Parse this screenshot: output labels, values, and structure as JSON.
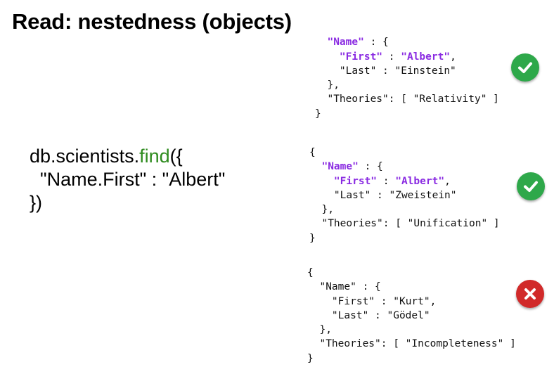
{
  "title": "Read: nestedness (objects)",
  "query": {
    "line1_prefix": "db.scientists.",
    "line1_fn": "find",
    "line1_suffix": "({",
    "line2": "  \"Name.First\" : \"Albert\"",
    "line3": "})"
  },
  "docs": [
    {
      "open_brace": "",
      "name_key": "\"Name\"",
      "name_open": " : {",
      "first_key": "\"First\"",
      "sep": " : ",
      "first_value": "\"Albert\"",
      "first_comma": ",",
      "last_line": "\"Last\" : \"Einstein\"",
      "name_close": "},",
      "theories_line": "\"Theories\": [ \"Relativity\" ]",
      "close_brace": "}",
      "result": "match",
      "result_icon": "check-icon"
    },
    {
      "open_brace": "{",
      "name_key": "\"Name\"",
      "name_open": " : {",
      "first_key": "\"First\"",
      "sep": " : ",
      "first_value": "\"Albert\"",
      "first_comma": ",",
      "last_line": "\"Last\" : \"Zweistein\"",
      "name_close": "},",
      "theories_line": "\"Theories\": [ \"Unification\" ]",
      "close_brace": "}",
      "result": "match",
      "result_icon": "check-icon"
    },
    {
      "open_brace": "{",
      "name_key": "\"Name\"",
      "name_open": " : {",
      "first_key": "\"First\"",
      "sep": " : ",
      "first_value": "\"Kurt\"",
      "first_comma": ",",
      "last_line": "\"Last\" : \"Gödel\"",
      "name_close": "},",
      "theories_line": "\"Theories\": [ \"Incompleteness\" ]",
      "close_brace": "}",
      "result": "no-match",
      "result_icon": "cross-icon"
    }
  ],
  "colors": {
    "highlight": "#8a2be2",
    "function": "#2e8b1e",
    "match": "#2ea84a",
    "no_match": "#d12a2a"
  }
}
